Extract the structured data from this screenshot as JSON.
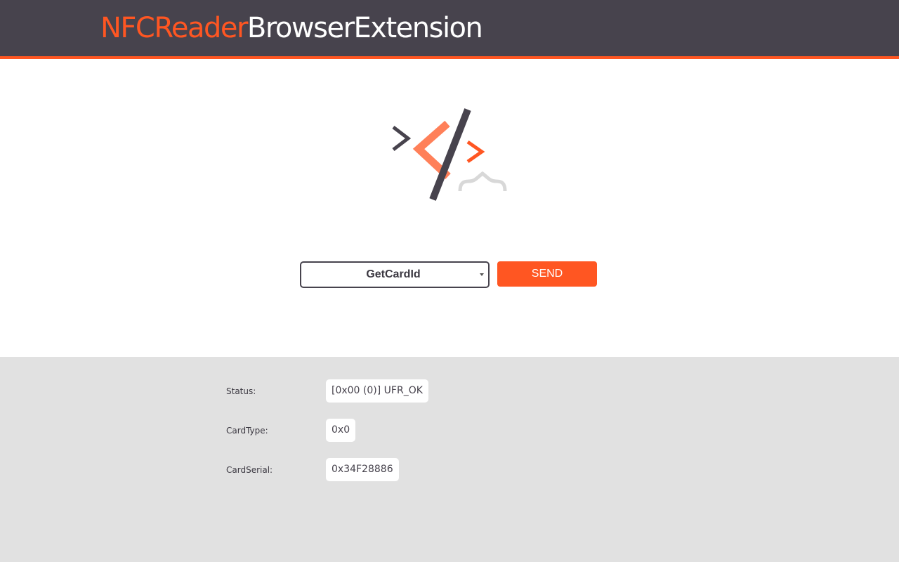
{
  "header": {
    "title_accent": "NFCReader",
    "title_rest": "BrowserExtension"
  },
  "colors": {
    "accent": "#ff5622",
    "header_bg": "#47434d",
    "results_bg": "#e1e1e1"
  },
  "logo": {
    "icon": "code-logo-icon"
  },
  "controls": {
    "command_selected": "GetCardId",
    "send_label": "SEND"
  },
  "results": {
    "rows": [
      {
        "label": "Status:",
        "value": "[0x00 (0)] UFR_OK"
      },
      {
        "label": "CardType:",
        "value": "0x0"
      },
      {
        "label": "CardSerial:",
        "value": "0x34F28886"
      }
    ]
  }
}
